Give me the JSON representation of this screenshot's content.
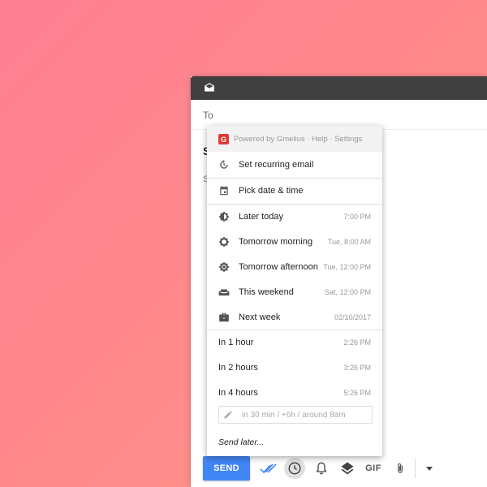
{
  "compose": {
    "to_label": "To",
    "subject_peek": "S",
    "body_peek": "S",
    "send_label": "SEND",
    "gif_label": "GIF"
  },
  "menu": {
    "powered_by": "Powered by Gmelius · Help · Settings",
    "logo_letter": "G",
    "recurring": "Set recurring email",
    "pick_date": "Pick date & time",
    "presets": [
      {
        "label": "Later today",
        "time": "7:00 PM",
        "icon": "brightness-icon"
      },
      {
        "label": "Tomorrow morning",
        "time": "Tue, 8:00 AM",
        "icon": "sun-outline-icon"
      },
      {
        "label": "Tomorrow afternoon",
        "time": "Tue, 12:00 PM",
        "icon": "sun-filled-icon"
      },
      {
        "label": "This weekend",
        "time": "Sat, 12:00 PM",
        "icon": "couch-icon"
      },
      {
        "label": "Next week",
        "time": "02/10/2017",
        "icon": "briefcase-icon"
      }
    ],
    "relative": [
      {
        "label": "In 1 hour",
        "time": "2:26 PM"
      },
      {
        "label": "In 2 hours",
        "time": "3:26 PM"
      },
      {
        "label": "In 4 hours",
        "time": "5:26 PM"
      }
    ],
    "custom_placeholder": "in 30 min / +6h / around 8am",
    "send_later": "Send later..."
  },
  "colors": {
    "send_button": "#4285f4",
    "header": "#404040",
    "gmelius_red": "#e53935"
  }
}
